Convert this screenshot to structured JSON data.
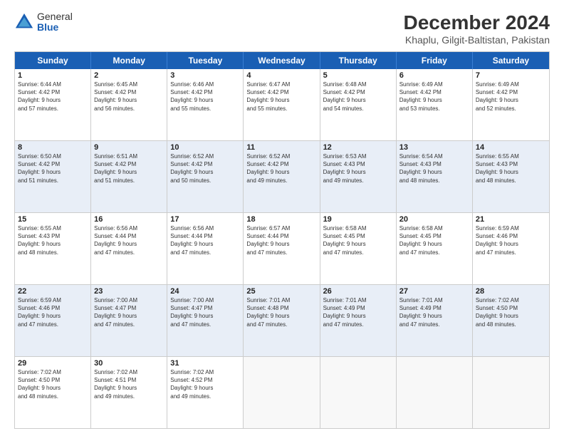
{
  "logo": {
    "general": "General",
    "blue": "Blue"
  },
  "title": "December 2024",
  "subtitle": "Khaplu, Gilgit-Baltistan, Pakistan",
  "header_days": [
    "Sunday",
    "Monday",
    "Tuesday",
    "Wednesday",
    "Thursday",
    "Friday",
    "Saturday"
  ],
  "weeks": [
    [
      {
        "day": "1",
        "info": "Sunrise: 6:44 AM\nSunset: 4:42 PM\nDaylight: 9 hours\nand 57 minutes.",
        "shaded": false
      },
      {
        "day": "2",
        "info": "Sunrise: 6:45 AM\nSunset: 4:42 PM\nDaylight: 9 hours\nand 56 minutes.",
        "shaded": false
      },
      {
        "day": "3",
        "info": "Sunrise: 6:46 AM\nSunset: 4:42 PM\nDaylight: 9 hours\nand 55 minutes.",
        "shaded": false
      },
      {
        "day": "4",
        "info": "Sunrise: 6:47 AM\nSunset: 4:42 PM\nDaylight: 9 hours\nand 55 minutes.",
        "shaded": false
      },
      {
        "day": "5",
        "info": "Sunrise: 6:48 AM\nSunset: 4:42 PM\nDaylight: 9 hours\nand 54 minutes.",
        "shaded": false
      },
      {
        "day": "6",
        "info": "Sunrise: 6:49 AM\nSunset: 4:42 PM\nDaylight: 9 hours\nand 53 minutes.",
        "shaded": false
      },
      {
        "day": "7",
        "info": "Sunrise: 6:49 AM\nSunset: 4:42 PM\nDaylight: 9 hours\nand 52 minutes.",
        "shaded": false
      }
    ],
    [
      {
        "day": "8",
        "info": "Sunrise: 6:50 AM\nSunset: 4:42 PM\nDaylight: 9 hours\nand 51 minutes.",
        "shaded": true
      },
      {
        "day": "9",
        "info": "Sunrise: 6:51 AM\nSunset: 4:42 PM\nDaylight: 9 hours\nand 51 minutes.",
        "shaded": true
      },
      {
        "day": "10",
        "info": "Sunrise: 6:52 AM\nSunset: 4:42 PM\nDaylight: 9 hours\nand 50 minutes.",
        "shaded": true
      },
      {
        "day": "11",
        "info": "Sunrise: 6:52 AM\nSunset: 4:42 PM\nDaylight: 9 hours\nand 49 minutes.",
        "shaded": true
      },
      {
        "day": "12",
        "info": "Sunrise: 6:53 AM\nSunset: 4:43 PM\nDaylight: 9 hours\nand 49 minutes.",
        "shaded": true
      },
      {
        "day": "13",
        "info": "Sunrise: 6:54 AM\nSunset: 4:43 PM\nDaylight: 9 hours\nand 48 minutes.",
        "shaded": true
      },
      {
        "day": "14",
        "info": "Sunrise: 6:55 AM\nSunset: 4:43 PM\nDaylight: 9 hours\nand 48 minutes.",
        "shaded": true
      }
    ],
    [
      {
        "day": "15",
        "info": "Sunrise: 6:55 AM\nSunset: 4:43 PM\nDaylight: 9 hours\nand 48 minutes.",
        "shaded": false
      },
      {
        "day": "16",
        "info": "Sunrise: 6:56 AM\nSunset: 4:44 PM\nDaylight: 9 hours\nand 47 minutes.",
        "shaded": false
      },
      {
        "day": "17",
        "info": "Sunrise: 6:56 AM\nSunset: 4:44 PM\nDaylight: 9 hours\nand 47 minutes.",
        "shaded": false
      },
      {
        "day": "18",
        "info": "Sunrise: 6:57 AM\nSunset: 4:44 PM\nDaylight: 9 hours\nand 47 minutes.",
        "shaded": false
      },
      {
        "day": "19",
        "info": "Sunrise: 6:58 AM\nSunset: 4:45 PM\nDaylight: 9 hours\nand 47 minutes.",
        "shaded": false
      },
      {
        "day": "20",
        "info": "Sunrise: 6:58 AM\nSunset: 4:45 PM\nDaylight: 9 hours\nand 47 minutes.",
        "shaded": false
      },
      {
        "day": "21",
        "info": "Sunrise: 6:59 AM\nSunset: 4:46 PM\nDaylight: 9 hours\nand 47 minutes.",
        "shaded": false
      }
    ],
    [
      {
        "day": "22",
        "info": "Sunrise: 6:59 AM\nSunset: 4:46 PM\nDaylight: 9 hours\nand 47 minutes.",
        "shaded": true
      },
      {
        "day": "23",
        "info": "Sunrise: 7:00 AM\nSunset: 4:47 PM\nDaylight: 9 hours\nand 47 minutes.",
        "shaded": true
      },
      {
        "day": "24",
        "info": "Sunrise: 7:00 AM\nSunset: 4:47 PM\nDaylight: 9 hours\nand 47 minutes.",
        "shaded": true
      },
      {
        "day": "25",
        "info": "Sunrise: 7:01 AM\nSunset: 4:48 PM\nDaylight: 9 hours\nand 47 minutes.",
        "shaded": true
      },
      {
        "day": "26",
        "info": "Sunrise: 7:01 AM\nSunset: 4:49 PM\nDaylight: 9 hours\nand 47 minutes.",
        "shaded": true
      },
      {
        "day": "27",
        "info": "Sunrise: 7:01 AM\nSunset: 4:49 PM\nDaylight: 9 hours\nand 47 minutes.",
        "shaded": true
      },
      {
        "day": "28",
        "info": "Sunrise: 7:02 AM\nSunset: 4:50 PM\nDaylight: 9 hours\nand 48 minutes.",
        "shaded": true
      }
    ],
    [
      {
        "day": "29",
        "info": "Sunrise: 7:02 AM\nSunset: 4:50 PM\nDaylight: 9 hours\nand 48 minutes.",
        "shaded": false
      },
      {
        "day": "30",
        "info": "Sunrise: 7:02 AM\nSunset: 4:51 PM\nDaylight: 9 hours\nand 49 minutes.",
        "shaded": false
      },
      {
        "day": "31",
        "info": "Sunrise: 7:02 AM\nSunset: 4:52 PM\nDaylight: 9 hours\nand 49 minutes.",
        "shaded": false
      },
      {
        "day": "",
        "info": "",
        "shaded": false,
        "empty": true
      },
      {
        "day": "",
        "info": "",
        "shaded": false,
        "empty": true
      },
      {
        "day": "",
        "info": "",
        "shaded": false,
        "empty": true
      },
      {
        "day": "",
        "info": "",
        "shaded": false,
        "empty": true
      }
    ]
  ]
}
